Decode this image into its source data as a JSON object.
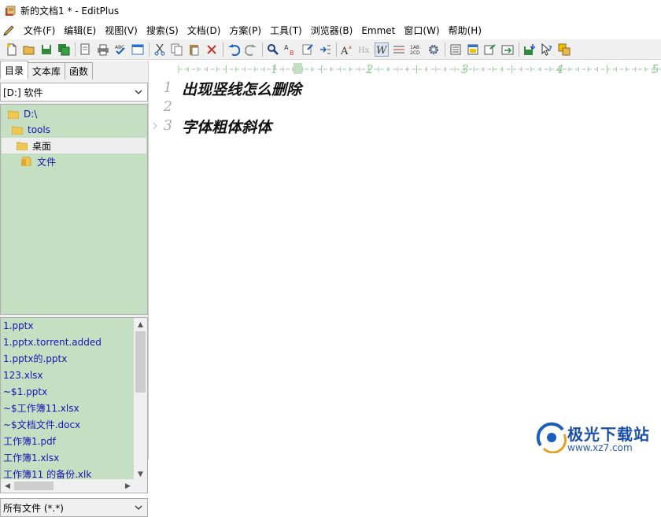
{
  "window": {
    "title": "新的文档1 * - EditPlus"
  },
  "menu": [
    "文件(F)",
    "编辑(E)",
    "视图(V)",
    "搜索(S)",
    "文档(D)",
    "方案(P)",
    "工具(T)",
    "浏览器(B)",
    "Emmet",
    "窗口(W)",
    "帮助(H)"
  ],
  "toolbar_icons": [
    "new-file-icon",
    "open-folder-icon",
    "save-icon",
    "save-all-icon",
    "print-preview-icon",
    "print-icon",
    "spell-check-icon",
    "browser-icon",
    "cut-icon",
    "copy-icon",
    "paste-icon",
    "delete-icon",
    "undo-icon",
    "redo-icon",
    "find-icon",
    "replace-icon",
    "goto-icon",
    "indent-icon",
    "font-size-icon",
    "hex-icon",
    "word-wrap-icon",
    "line-number-icon",
    "column-icon",
    "settings-icon",
    "doc-list-icon",
    "doc-view-icon",
    "output-icon",
    "ftp-icon",
    "save-remote-icon",
    "help-cursor-icon",
    "tools-icon"
  ],
  "sidebar": {
    "tabs": [
      "目录",
      "文本库",
      "函数"
    ],
    "drive": "[D:] 软件",
    "tree": [
      {
        "label": "D:\\",
        "level": 0
      },
      {
        "label": "tools",
        "level": 1
      },
      {
        "label": "桌面",
        "level": 2,
        "selected": true
      },
      {
        "label": "文件",
        "level": 3
      }
    ],
    "files": [
      "1.pptx",
      "1.pptx.torrent.added",
      "1.pptx的.pptx",
      "123.xlsx",
      "~$1.pptx",
      "~$工作簿11.xlsx",
      "~$文档文件.docx",
      "工作簿1.pdf",
      "工作簿1.xlsx",
      "工作簿11 的备份.xlk"
    ],
    "filter": "所有文件 (*.*)"
  },
  "editor": {
    "ruler_marks": [
      "1",
      "2",
      "3",
      "4",
      "5"
    ],
    "lines": [
      {
        "num": "1",
        "text": "出现竖线怎么删除"
      },
      {
        "num": "2",
        "text": ""
      },
      {
        "num": "3",
        "text": "字体粗体斜体"
      }
    ]
  },
  "watermark": {
    "title": "极光下载站",
    "url": "www.xz7.com"
  },
  "colors": {
    "panel_green": "#c5dfc3",
    "link_blue": "#1515b5",
    "ruler_green": "#9bc89b"
  }
}
